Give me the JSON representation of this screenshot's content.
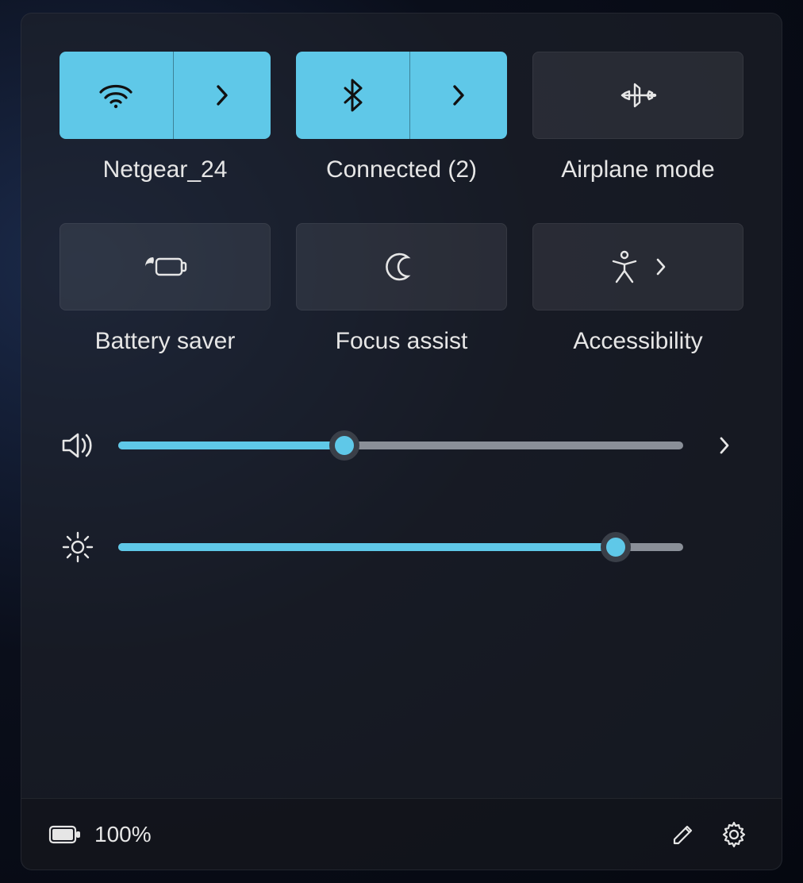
{
  "accent": "#5fc8e8",
  "tiles": [
    {
      "icon": "wifi-icon",
      "label": "Netgear_24",
      "active": true,
      "expandable": true
    },
    {
      "icon": "bluetooth-icon",
      "label": "Connected (2)",
      "active": true,
      "expandable": true
    },
    {
      "icon": "airplane-icon",
      "label": "Airplane mode",
      "active": false,
      "expandable": false
    },
    {
      "icon": "battery-saver-icon",
      "label": "Battery saver",
      "active": false,
      "expandable": false
    },
    {
      "icon": "focus-assist-icon",
      "label": "Focus assist",
      "active": false,
      "expandable": false
    },
    {
      "icon": "accessibility-icon",
      "label": "Accessibility",
      "active": false,
      "expandable": true
    }
  ],
  "sliders": {
    "volume": {
      "icon": "speaker-icon",
      "value": 40,
      "has_flyout": true
    },
    "brightness": {
      "icon": "brightness-icon",
      "value": 88,
      "has_flyout": false
    }
  },
  "footer": {
    "battery_percent": "100%",
    "edit_icon": "pencil-icon",
    "settings_icon": "gear-icon"
  }
}
